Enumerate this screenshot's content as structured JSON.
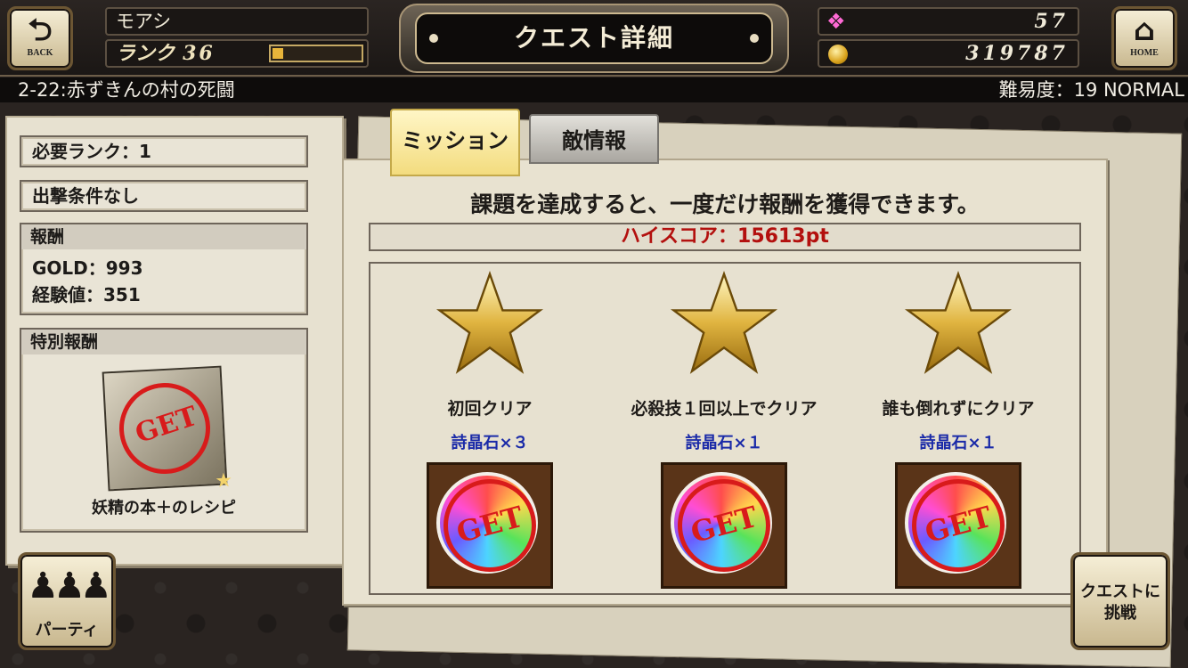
{
  "header": {
    "back_icon_glyph": "⮌",
    "back_label": "BACK",
    "home_icon_glyph": "⌂",
    "home_label": "HOME",
    "player_name": "モアシ",
    "rank_label": "ランク",
    "rank_value": "36",
    "rank_progress": 0.12,
    "title": "クエスト詳細",
    "gem_count": "57",
    "gold_count": "319787"
  },
  "subheader": {
    "quest_name": "2-22:赤ずきんの村の死闘",
    "difficulty": "難易度：19 NORMAL"
  },
  "left_panel": {
    "required_rank": "必要ランク：1",
    "sortie_condition": "出撃条件なし",
    "reward_header": "報酬",
    "reward_gold": "GOLD：993",
    "reward_exp": "経験値：351",
    "special_reward_header": "特別報酬",
    "special_reward_item_label": "GET",
    "special_reward_name": "妖精の本＋のレシピ"
  },
  "tabs": [
    {
      "label": "ミッション",
      "active": true
    },
    {
      "label": "敵情報",
      "active": false
    }
  ],
  "mission_panel": {
    "description": "課題を達成すると、一度だけ報酬を獲得できます。",
    "high_score": "ハイスコア：15613pt",
    "missions": [
      {
        "condition": "初回クリア",
        "reward": "詩晶石×３",
        "badge_label": "GET"
      },
      {
        "condition": "必殺技１回以上でクリア",
        "reward": "詩晶石×１",
        "badge_label": "GET"
      },
      {
        "condition": "誰も倒れずにクリア",
        "reward": "詩晶石×１",
        "badge_label": "GET"
      }
    ]
  },
  "buttons": {
    "party_label": "パーティ",
    "challenge_label_line1": "クエストに",
    "challenge_label_line2": "挑戦"
  },
  "colors": {
    "high_score_red": "#b3100e",
    "reward_blue": "#1a2aa8",
    "active_tab_yellow": "#f3dc7f"
  }
}
